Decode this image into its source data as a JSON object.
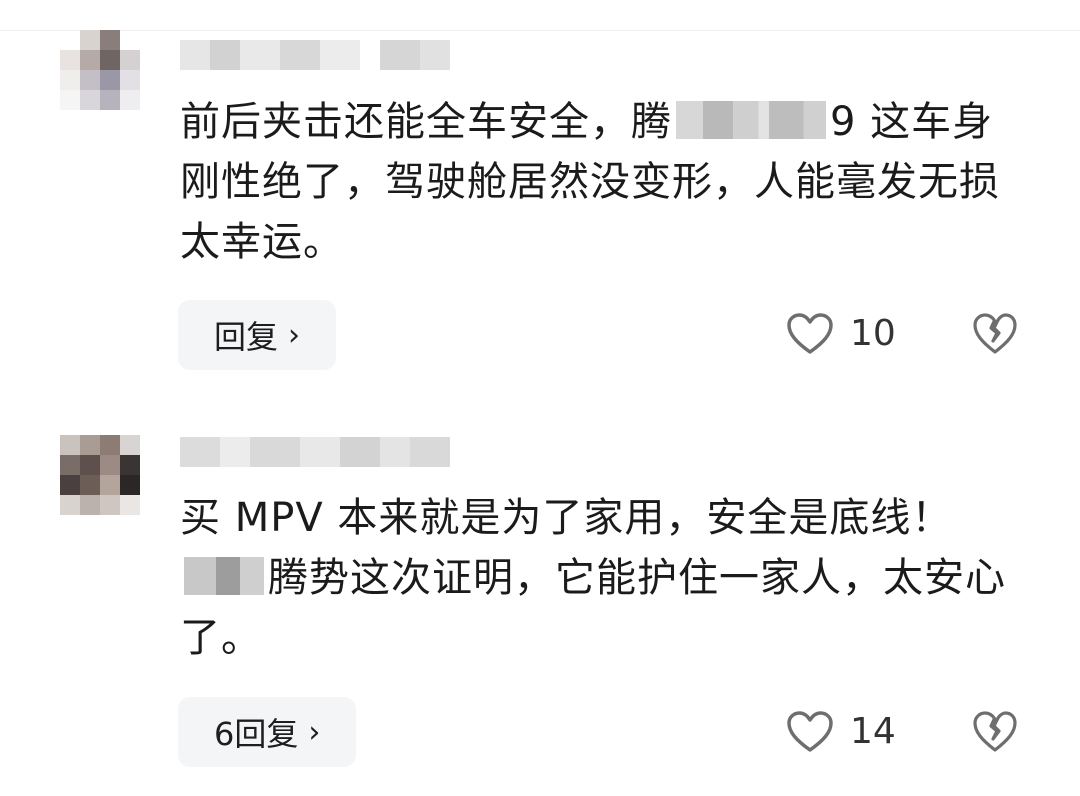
{
  "comments": [
    {
      "text_before": "前后夹击还能全车安全，",
      "text_blur_tail": "腾",
      "text_after": "9 这车身刚性绝了，驾驶舱居然没变形，人能毫发无损太幸运。",
      "reply_label": "回复",
      "likes": "10",
      "icons": {
        "like": "heart-outline-icon",
        "dislike": "broken-heart-icon",
        "reply_arrow": "chevron-right-icon"
      }
    },
    {
      "text_before": "买 MPV 本来就是为了家用，安全是底线！",
      "text_blur_tail": "",
      "text_after": "腾势这次证明，它能护住一家人，太安心了。",
      "reply_label": "6回复",
      "likes": "14",
      "icons": {
        "like": "heart-outline-icon",
        "dislike": "broken-heart-icon",
        "reply_arrow": "chevron-right-icon"
      }
    }
  ],
  "colors": {
    "background": "#ffffff",
    "text": "#1b1b1b",
    "button_bg": "#f4f5f7",
    "icon": "#6e6e6e"
  }
}
